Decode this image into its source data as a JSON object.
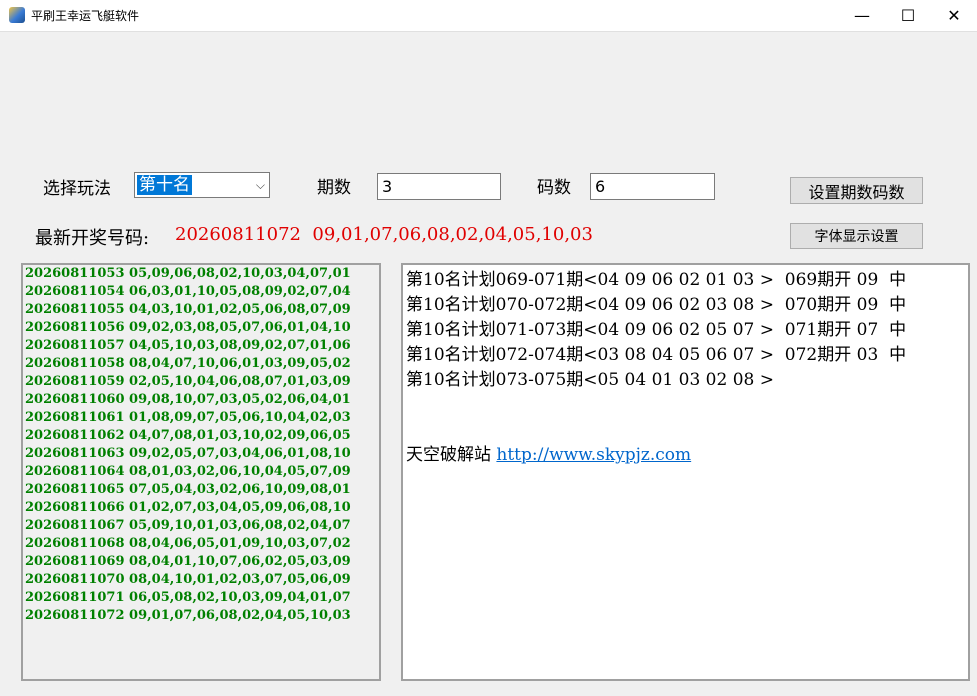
{
  "window": {
    "title": "平刷王幸运飞艇软件",
    "minimize": "—",
    "maximize": "☐",
    "close": "✕"
  },
  "controls": {
    "play_label": "选择玩法",
    "play_selected": "第十名",
    "periods_label": "期数",
    "periods_value": "3",
    "codes_label": "码数",
    "codes_value": "6",
    "set_button": "设置期数码数",
    "font_button": "字体显示设置"
  },
  "latest": {
    "label": "最新开奖号码:",
    "value": "20260811072  09,01,07,06,08,02,04,05,10,03"
  },
  "history": [
    "20260811053 05,09,06,08,02,10,03,04,07,01",
    "20260811054 06,03,01,10,05,08,09,02,07,04",
    "20260811055 04,03,10,01,02,05,06,08,07,09",
    "20260811056 09,02,03,08,05,07,06,01,04,10",
    "20260811057 04,05,10,03,08,09,02,07,01,06",
    "20260811058 08,04,07,10,06,01,03,09,05,02",
    "20260811059 02,05,10,04,06,08,07,01,03,09",
    "20260811060 09,08,10,07,03,05,02,06,04,01",
    "20260811061 01,08,09,07,05,06,10,04,02,03",
    "20260811062 04,07,08,01,03,10,02,09,06,05",
    "20260811063 09,02,05,07,03,04,06,01,08,10",
    "20260811064 08,01,03,02,06,10,04,05,07,09",
    "20260811065 07,05,04,03,02,06,10,09,08,01",
    "20260811066 01,02,07,03,04,05,09,06,08,10",
    "20260811067 05,09,10,01,03,06,08,02,04,07",
    "20260811068 08,04,06,05,01,09,10,03,07,02",
    "20260811069 08,04,01,10,07,06,02,05,03,09",
    "20260811070 08,04,10,01,02,03,07,05,06,09",
    "20260811071 06,05,08,02,10,03,09,04,01,07",
    "20260811072 09,01,07,06,08,02,04,05,10,03"
  ],
  "plans": [
    "第10名计划069-071期<04 09 06 02 01 03 >  069期开 09  中",
    "第10名计划070-072期<04 09 06 02 03 08 >  070期开 09  中",
    "第10名计划071-073期<04 09 06 02 05 07 >  071期开 07  中",
    "第10名计划072-074期<03 08 04 05 06 07 >  072期开 03  中",
    "第10名计划073-075期<05 04 01 03 02 08 >"
  ],
  "footer": {
    "site_label": "天空破解站 ",
    "site_link": "http://www.skypjz.com"
  },
  "colors": {
    "latest_value": "#e00000",
    "history_text": "#008000",
    "selection": "#0078d7",
    "link": "#0066cc"
  }
}
